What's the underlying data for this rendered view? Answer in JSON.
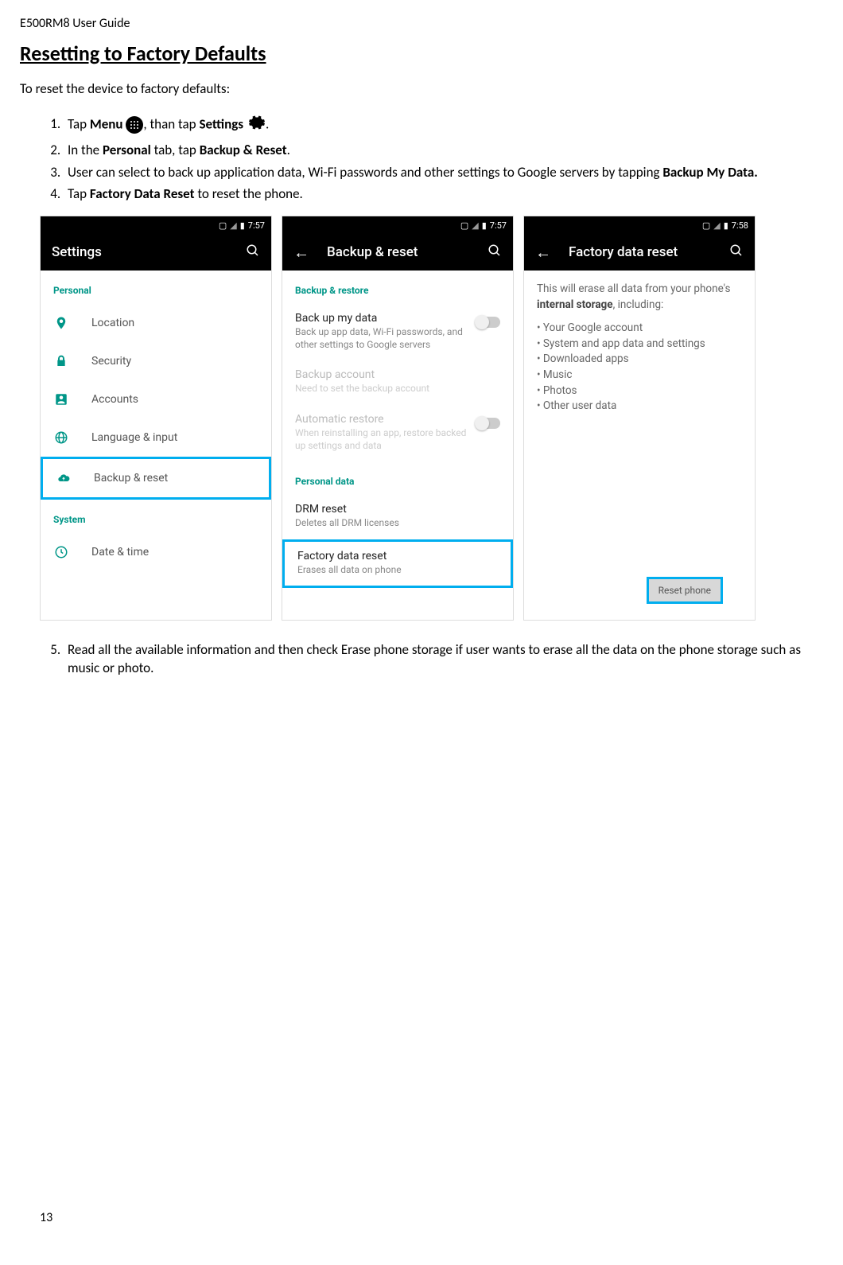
{
  "header": "E500RM8 User Guide",
  "title": "Resetting to Factory Defaults",
  "intro": "To reset the device to factory defaults:",
  "steps": {
    "s1a": "Tap ",
    "s1b": "Menu",
    "s1c": ", than tap ",
    "s1d": "Settings",
    "s1e": ".",
    "s2a": "In the ",
    "s2b": "Personal",
    "s2c": " tab, tap ",
    "s2d": "Backup & Reset",
    "s2e": ".",
    "s3a": "User can select to back up application data, Wi-Fi passwords and other settings to Google servers by tapping ",
    "s3b": "Backup My Data.",
    "s4a": "Tap ",
    "s4b": "Factory Data Reset",
    "s4c": " to reset the phone.",
    "s5": "Read all the available information and then check Erase phone storage if user wants to erase all the data on the phone storage such as music or photo."
  },
  "screen1": {
    "time": "7:57",
    "title": "Settings",
    "section1": "Personal",
    "items": [
      "Location",
      "Security",
      "Accounts",
      "Language & input",
      "Backup & reset"
    ],
    "section2": "System",
    "items2": [
      "Date & time"
    ]
  },
  "screen2": {
    "time": "7:57",
    "title": "Backup & reset",
    "section1": "Backup & restore",
    "backup_title": "Back up my data",
    "backup_sub": "Back up app data, Wi-Fi passwords, and other settings to Google servers",
    "acct_title": "Backup account",
    "acct_sub": "Need to set the backup account",
    "auto_title": "Automatic restore",
    "auto_sub": "When reinstalling an app, restore backed up settings and data",
    "section2": "Personal data",
    "drm_title": "DRM reset",
    "drm_sub": "Deletes all DRM licenses",
    "factory_title": "Factory data reset",
    "factory_sub": "Erases all data on phone"
  },
  "screen3": {
    "time": "7:58",
    "title": "Factory data reset",
    "line1a": "This will erase all data from your phone's ",
    "line1b": "internal storage",
    "line1c": ", including:",
    "bullets": [
      "Your Google account",
      "System and app data and settings",
      "Downloaded apps",
      "Music",
      "Photos",
      "Other user data"
    ],
    "button": "Reset phone"
  },
  "page_num": "13"
}
